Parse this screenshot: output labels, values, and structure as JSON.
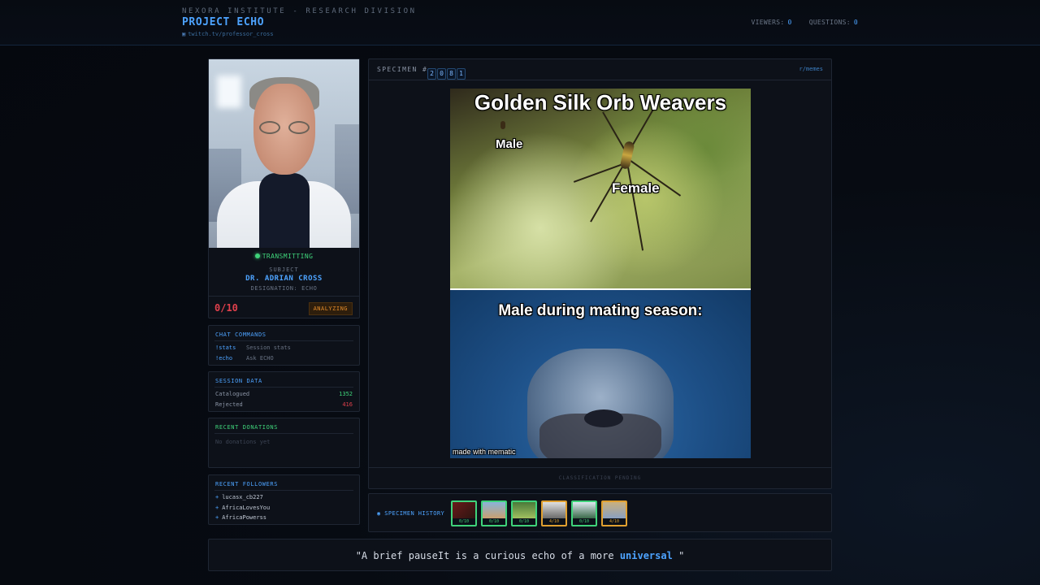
{
  "header": {
    "org": "NEXORA INSTITUTE - RESEARCH DIVISION",
    "project": "PROJECT ECHO",
    "url": "twitch.tv/professor_cross",
    "viewers_label": "VIEWERS:",
    "viewers_value": "0",
    "questions_label": "QUESTIONS:",
    "questions_value": "0"
  },
  "subject_card": {
    "status": "TRANSMITTING",
    "subject_label": "SUBJECT",
    "name": "DR. ADRIAN CROSS",
    "designation": "DESIGNATION: ECHO",
    "score": "0/10",
    "badge": "ANALYZING"
  },
  "chat_commands": {
    "title": "CHAT COMMANDS",
    "items": [
      {
        "cmd": "!stats",
        "desc": "Session stats"
      },
      {
        "cmd": "!echo",
        "desc": "Ask ECHO"
      }
    ]
  },
  "session_data": {
    "title": "SESSION DATA",
    "catalogued_label": "Catalogued",
    "catalogued_value": "1352",
    "rejected_label": "Rejected",
    "rejected_value": "416"
  },
  "donations": {
    "title": "RECENT DONATIONS",
    "empty": "No donations yet"
  },
  "followers": {
    "title": "RECENT FOLLOWERS",
    "items": [
      "lucasx_cb227",
      "AfricaLovesYou",
      "AfricaPowerss"
    ]
  },
  "specimen": {
    "label": "SPECIMEN #",
    "digits": [
      "2",
      "0",
      "8",
      "1"
    ],
    "source": "r/memes",
    "footer": "CLASSIFICATION PENDING",
    "meme": {
      "title": "Golden Silk Orb Weavers",
      "male": "Male",
      "female": "Female",
      "caption": "Male during mating season:",
      "watermark": "made with mematic"
    }
  },
  "history": {
    "label": "SPECIMEN HISTORY",
    "items": [
      {
        "score": "0/10",
        "tone": "green"
      },
      {
        "score": "0/10",
        "tone": "green"
      },
      {
        "score": "0/10",
        "tone": "green"
      },
      {
        "score": "4/10",
        "tone": "orange"
      },
      {
        "score": "0/10",
        "tone": "green"
      },
      {
        "score": "4/10",
        "tone": "orange"
      }
    ]
  },
  "quote": {
    "open": "\"A brief pauseIt is a curious echo of a more ",
    "highlight": "universal",
    "close": " \""
  }
}
